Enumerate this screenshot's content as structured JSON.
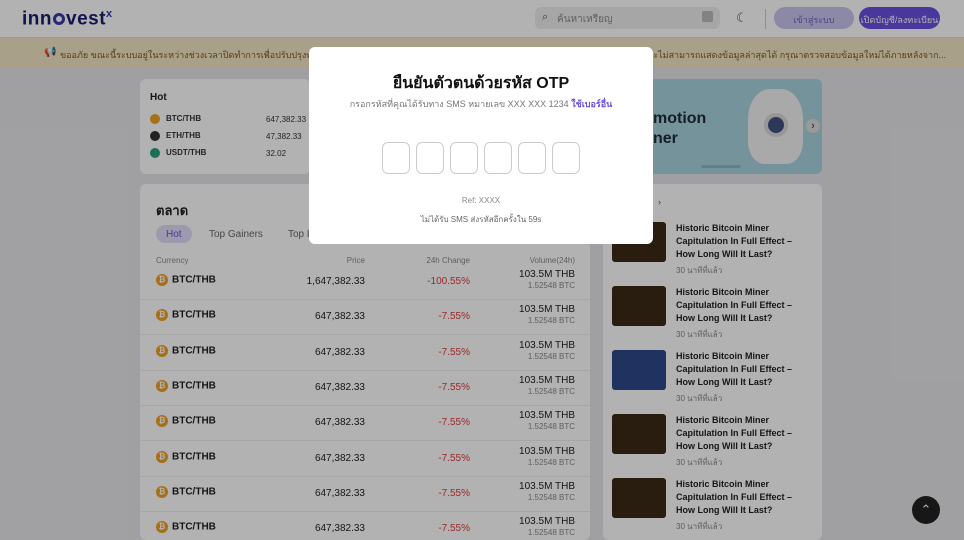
{
  "header": {
    "logo": "inn",
    "logo_rest": "vest",
    "logo_sup": "x",
    "search_placeholder": "ค้นหาเหรียญ",
    "login": "เข้าสู่ระบบ",
    "signup": "เปิดบัญชี/ลงทะเบียน"
  },
  "notice": {
    "left": "ขออภัย ขณะนี้ระบบอยู่ในระหว่างช่วงเวลาปิดทำการเพื่อปรับปรุงพัฒนาการ",
    "right": "จะไม่สามารถแสดงข้อมูลล่าสุดได้ กรุณาตรวจสอบข้อมูลใหม่ได้ภายหลังจาก..."
  },
  "hot": {
    "title": "Hot",
    "rows": [
      {
        "pair": "BTC/THB",
        "price": "647,382.33",
        "color": "#f0a020"
      },
      {
        "pair": "ETH/THB",
        "price": "47,382.33",
        "color": "#333333"
      },
      {
        "pair": "USDT/THB",
        "price": "32.02",
        "color": "#26a17b"
      }
    ]
  },
  "promo": {
    "line1": "motion",
    "line2": "ner"
  },
  "market": {
    "title": "ตลาด",
    "tabs": [
      "Hot",
      "Top Gainers",
      "Top L"
    ],
    "cols": {
      "currency": "Currency",
      "price": "Price",
      "change": "24h Change",
      "volume": "Volume(24h)"
    },
    "rows": [
      {
        "pair": "BTC/THB",
        "price": "1,647,382.33",
        "change": "-100.55%",
        "vol": "103.5M THB",
        "vol_btc": "1.52548 BTC"
      },
      {
        "pair": "BTC/THB",
        "price": "647,382.33",
        "change": "-7.55%",
        "vol": "103.5M THB",
        "vol_btc": "1.52548 BTC"
      },
      {
        "pair": "BTC/THB",
        "price": "647,382.33",
        "change": "-7.55%",
        "vol": "103.5M THB",
        "vol_btc": "1.52548 BTC"
      },
      {
        "pair": "BTC/THB",
        "price": "647,382.33",
        "change": "-7.55%",
        "vol": "103.5M THB",
        "vol_btc": "1.52548 BTC"
      },
      {
        "pair": "BTC/THB",
        "price": "647,382.33",
        "change": "-7.55%",
        "vol": "103.5M THB",
        "vol_btc": "1.52548 BTC"
      },
      {
        "pair": "BTC/THB",
        "price": "647,382.33",
        "change": "-7.55%",
        "vol": "103.5M THB",
        "vol_btc": "1.52548 BTC"
      },
      {
        "pair": "BTC/THB",
        "price": "647,382.33",
        "change": "-7.55%",
        "vol": "103.5M THB",
        "vol_btc": "1.52548 BTC"
      },
      {
        "pair": "BTC/THB",
        "price": "647,382.33",
        "change": "-7.55%",
        "vol": "103.5M THB",
        "vol_btc": "1.52548 BTC"
      }
    ]
  },
  "news": {
    "items": [
      {
        "headline": "Historic Bitcoin Miner Capitulation In Full Effect – How Long Will It Last?",
        "time": "30 นาทีที่แล้ว",
        "thumb": "dark"
      },
      {
        "headline": "Historic Bitcoin Miner Capitulation In Full Effect – How Long Will It Last?",
        "time": "30 นาทีที่แล้ว",
        "thumb": "dark"
      },
      {
        "headline": "Historic Bitcoin Miner Capitulation In Full Effect – How Long Will It Last?",
        "time": "30 นาทีที่แล้ว",
        "thumb": "blue"
      },
      {
        "headline": "Historic Bitcoin Miner Capitulation In Full Effect – How Long Will It Last?",
        "time": "30 นาทีที่แล้ว",
        "thumb": "dark"
      },
      {
        "headline": "Historic Bitcoin Miner Capitulation In Full Effect – How Long Will It Last?",
        "time": "30 นาทีที่แล้ว",
        "thumb": "dark"
      }
    ]
  },
  "modal": {
    "title": "ยืนยันตัวตนด้วยรหัส OTP",
    "subtitle": "กรอกรหัสที่คุณได้รับทาง SMS หมายเลข XXX XXX 1234",
    "other_number": "ใช้เบอร์อื่น",
    "otp_count": 6,
    "ref": "Ref: XXXX",
    "resend": "ไม่ได้รับ SMS ส่งรหัสอีกครั้งใน 59s"
  }
}
